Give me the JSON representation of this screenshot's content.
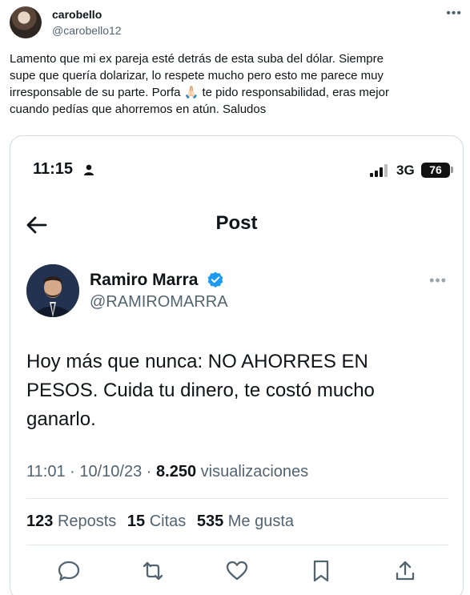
{
  "outer_tweet": {
    "display_name": "carobello",
    "handle": "@carobello12",
    "more_icon": "more-horizontal-icon",
    "text_lines": [
      "Lamento que mi ex pareja esté detrás de esta suba del dólar. Siempre",
      "supe que quería dolarizar, lo respete mucho pero esto me parece muy",
      "irresponsable de su parte. Porfa 🙏🏻 te pido responsabilidad, eras mejor",
      "cuando pedías que ahorremos en atún. Saludos"
    ]
  },
  "screenshot": {
    "status_bar": {
      "time": "11:15",
      "network": "3G",
      "battery": "76"
    },
    "nav": {
      "title": "Post",
      "back_icon": "arrow-left-icon"
    },
    "author": {
      "display_name": "Ramiro Marra",
      "handle": "@RAMIROMARRA",
      "verified_color": "#1d9bf0"
    },
    "post_lines": [
      "Hoy más que nunca: NO AHORRES EN",
      "PESOS. Cuida tu dinero, te costó mucho",
      "ganarlo."
    ],
    "meta": {
      "time": "11:01",
      "separator": "·",
      "date": "10/10/23",
      "views_count": "8.250",
      "views_label": "visualizaciones"
    },
    "stats": {
      "reposts_count": "123",
      "reposts_label": "Reposts",
      "quotes_count": "15",
      "quotes_label": "Citas",
      "likes_count": "535",
      "likes_label": "Me gusta"
    },
    "actions": [
      "reply-icon",
      "repost-icon",
      "like-icon",
      "bookmark-icon",
      "share-icon"
    ]
  }
}
